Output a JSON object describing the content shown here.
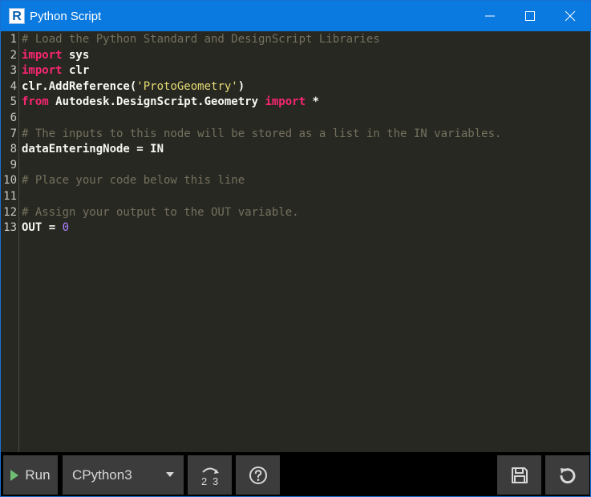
{
  "window": {
    "title": "Python Script",
    "app_icon_letter": "R"
  },
  "editor": {
    "line_numbers": [
      "1",
      "2",
      "3",
      "4",
      "5",
      "6",
      "7",
      "8",
      "9",
      "10",
      "11",
      "12",
      "13"
    ],
    "lines": {
      "l1": {
        "comment": "# Load the Python Standard and DesignScript Libraries"
      },
      "l2": {
        "kw": "import",
        "rest": " sys"
      },
      "l3": {
        "kw": "import",
        "rest": " clr"
      },
      "l4": {
        "pre": "clr.AddReference(",
        "str": "'ProtoGeometry'",
        "post": ")"
      },
      "l5": {
        "kw1": "from",
        "mid": " Autodesk.DesignScript.Geometry ",
        "kw2": "import",
        "post": " *"
      },
      "l7": {
        "comment": "# The inputs to this node will be stored as a list in the IN variables."
      },
      "l8": {
        "text": "dataEnteringNode = IN"
      },
      "l10": {
        "comment": "# Place your code below this line"
      },
      "l12": {
        "comment": "# Assign your output to the OUT variable."
      },
      "l13": {
        "pre": "OUT = ",
        "num": "0"
      }
    }
  },
  "toolbar": {
    "run_label": "Run",
    "engine_selected": "CPython3",
    "colors": {
      "button_bg": "#3c3c3c",
      "run_triangle": "#6fbf73",
      "bar_bg": "#000000"
    }
  },
  "colors": {
    "titlebar": "#0b7ae0",
    "editor_bg": "#272822",
    "comment": "#75715e",
    "keyword": "#f92672",
    "string": "#e6db74",
    "number": "#ae81ff",
    "text": "#f8f8f2"
  }
}
